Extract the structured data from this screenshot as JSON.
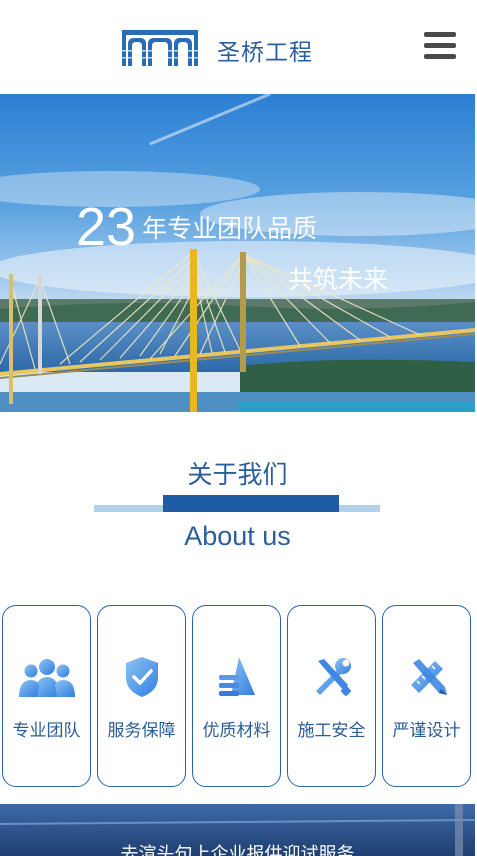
{
  "header": {
    "brand": "圣桥工程",
    "logo_icon": "bridge-arches-logo",
    "menu_icon": "hamburger-menu-icon"
  },
  "banner": {
    "years": "23",
    "line1": "年专业团队品质",
    "line2": "共筑未来"
  },
  "about": {
    "title": "关于我们",
    "subtitle": "About us"
  },
  "features": [
    {
      "label": "专业团队",
      "icon": "team-icon"
    },
    {
      "label": "服务保障",
      "icon": "shield-check-icon"
    },
    {
      "label": "优质材料",
      "icon": "materials-icon"
    },
    {
      "label": "施工安全",
      "icon": "tools-icon"
    },
    {
      "label": "严谨设计",
      "icon": "pencil-ruler-icon"
    }
  ],
  "footer": {
    "text": "去渲头句上企业报供迎试服务"
  },
  "colors": {
    "brand": "#2c5f9e",
    "accent": "#1e5da5",
    "icon_gradient_start": "#8fc3f3",
    "icon_gradient_end": "#2f7ee0"
  }
}
